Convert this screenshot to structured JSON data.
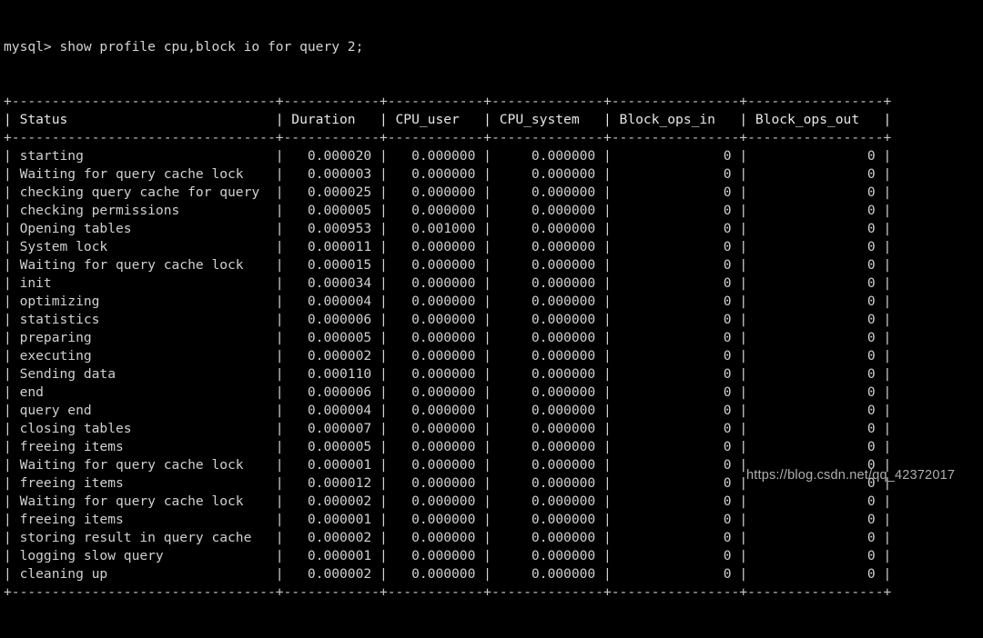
{
  "terminal": {
    "prompt": "mysql> ",
    "command": "show profile cpu,block io for query 2;",
    "prompt_line": "mysql> show profile cpu,block io for query 2;",
    "watermark": "https://blog.csdn.net/qq_42372017",
    "background_color": "#000000",
    "text_color": "#cfcfcf"
  },
  "table": {
    "columns": [
      {
        "name": "Status",
        "width": 31,
        "align": "left"
      },
      {
        "name": "Duration",
        "width": 10,
        "align": "right"
      },
      {
        "name": "CPU_user",
        "width": 10,
        "align": "right"
      },
      {
        "name": "CPU_system",
        "width": 12,
        "align": "right"
      },
      {
        "name": "Block_ops_in",
        "width": 14,
        "align": "right"
      },
      {
        "name": "Block_ops_out",
        "width": 15,
        "align": "right"
      }
    ],
    "rows": [
      {
        "status": "starting",
        "duration": "0.000020",
        "cpu_user": "0.000000",
        "cpu_system": "0.000000",
        "block_ops_in": "0",
        "block_ops_out": "0"
      },
      {
        "status": "Waiting for query cache lock",
        "duration": "0.000003",
        "cpu_user": "0.000000",
        "cpu_system": "0.000000",
        "block_ops_in": "0",
        "block_ops_out": "0"
      },
      {
        "status": "checking query cache for query",
        "duration": "0.000025",
        "cpu_user": "0.000000",
        "cpu_system": "0.000000",
        "block_ops_in": "0",
        "block_ops_out": "0"
      },
      {
        "status": "checking permissions",
        "duration": "0.000005",
        "cpu_user": "0.000000",
        "cpu_system": "0.000000",
        "block_ops_in": "0",
        "block_ops_out": "0"
      },
      {
        "status": "Opening tables",
        "duration": "0.000953",
        "cpu_user": "0.001000",
        "cpu_system": "0.000000",
        "block_ops_in": "0",
        "block_ops_out": "0"
      },
      {
        "status": "System lock",
        "duration": "0.000011",
        "cpu_user": "0.000000",
        "cpu_system": "0.000000",
        "block_ops_in": "0",
        "block_ops_out": "0"
      },
      {
        "status": "Waiting for query cache lock",
        "duration": "0.000015",
        "cpu_user": "0.000000",
        "cpu_system": "0.000000",
        "block_ops_in": "0",
        "block_ops_out": "0"
      },
      {
        "status": "init",
        "duration": "0.000034",
        "cpu_user": "0.000000",
        "cpu_system": "0.000000",
        "block_ops_in": "0",
        "block_ops_out": "0"
      },
      {
        "status": "optimizing",
        "duration": "0.000004",
        "cpu_user": "0.000000",
        "cpu_system": "0.000000",
        "block_ops_in": "0",
        "block_ops_out": "0"
      },
      {
        "status": "statistics",
        "duration": "0.000006",
        "cpu_user": "0.000000",
        "cpu_system": "0.000000",
        "block_ops_in": "0",
        "block_ops_out": "0"
      },
      {
        "status": "preparing",
        "duration": "0.000005",
        "cpu_user": "0.000000",
        "cpu_system": "0.000000",
        "block_ops_in": "0",
        "block_ops_out": "0"
      },
      {
        "status": "executing",
        "duration": "0.000002",
        "cpu_user": "0.000000",
        "cpu_system": "0.000000",
        "block_ops_in": "0",
        "block_ops_out": "0"
      },
      {
        "status": "Sending data",
        "duration": "0.000110",
        "cpu_user": "0.000000",
        "cpu_system": "0.000000",
        "block_ops_in": "0",
        "block_ops_out": "0"
      },
      {
        "status": "end",
        "duration": "0.000006",
        "cpu_user": "0.000000",
        "cpu_system": "0.000000",
        "block_ops_in": "0",
        "block_ops_out": "0"
      },
      {
        "status": "query end",
        "duration": "0.000004",
        "cpu_user": "0.000000",
        "cpu_system": "0.000000",
        "block_ops_in": "0",
        "block_ops_out": "0"
      },
      {
        "status": "closing tables",
        "duration": "0.000007",
        "cpu_user": "0.000000",
        "cpu_system": "0.000000",
        "block_ops_in": "0",
        "block_ops_out": "0"
      },
      {
        "status": "freeing items",
        "duration": "0.000005",
        "cpu_user": "0.000000",
        "cpu_system": "0.000000",
        "block_ops_in": "0",
        "block_ops_out": "0"
      },
      {
        "status": "Waiting for query cache lock",
        "duration": "0.000001",
        "cpu_user": "0.000000",
        "cpu_system": "0.000000",
        "block_ops_in": "0",
        "block_ops_out": "0"
      },
      {
        "status": "freeing items",
        "duration": "0.000012",
        "cpu_user": "0.000000",
        "cpu_system": "0.000000",
        "block_ops_in": "0",
        "block_ops_out": "0"
      },
      {
        "status": "Waiting for query cache lock",
        "duration": "0.000002",
        "cpu_user": "0.000000",
        "cpu_system": "0.000000",
        "block_ops_in": "0",
        "block_ops_out": "0"
      },
      {
        "status": "freeing items",
        "duration": "0.000001",
        "cpu_user": "0.000000",
        "cpu_system": "0.000000",
        "block_ops_in": "0",
        "block_ops_out": "0"
      },
      {
        "status": "storing result in query cache",
        "duration": "0.000002",
        "cpu_user": "0.000000",
        "cpu_system": "0.000000",
        "block_ops_in": "0",
        "block_ops_out": "0"
      },
      {
        "status": "logging slow query",
        "duration": "0.000001",
        "cpu_user": "0.000000",
        "cpu_system": "0.000000",
        "block_ops_in": "0",
        "block_ops_out": "0"
      },
      {
        "status": "cleaning up",
        "duration": "0.000002",
        "cpu_user": "0.000000",
        "cpu_system": "0.000000",
        "block_ops_in": "0",
        "block_ops_out": "0"
      }
    ]
  }
}
